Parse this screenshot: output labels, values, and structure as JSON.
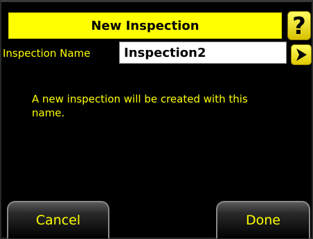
{
  "dialog": {
    "title": "New Inspection",
    "help_icon": "question-mark-icon",
    "help_symbol": "?"
  },
  "form": {
    "name_label": "Inspection Name",
    "name_value": "Inspection2",
    "next_icon": "arrow-right-icon"
  },
  "message": "A new inspection will be created with this name.",
  "buttons": {
    "cancel_label": "Cancel",
    "done_label": "Done"
  },
  "colors": {
    "accent": "#ffff00",
    "background": "#000000",
    "text_on_accent": "#000000"
  }
}
